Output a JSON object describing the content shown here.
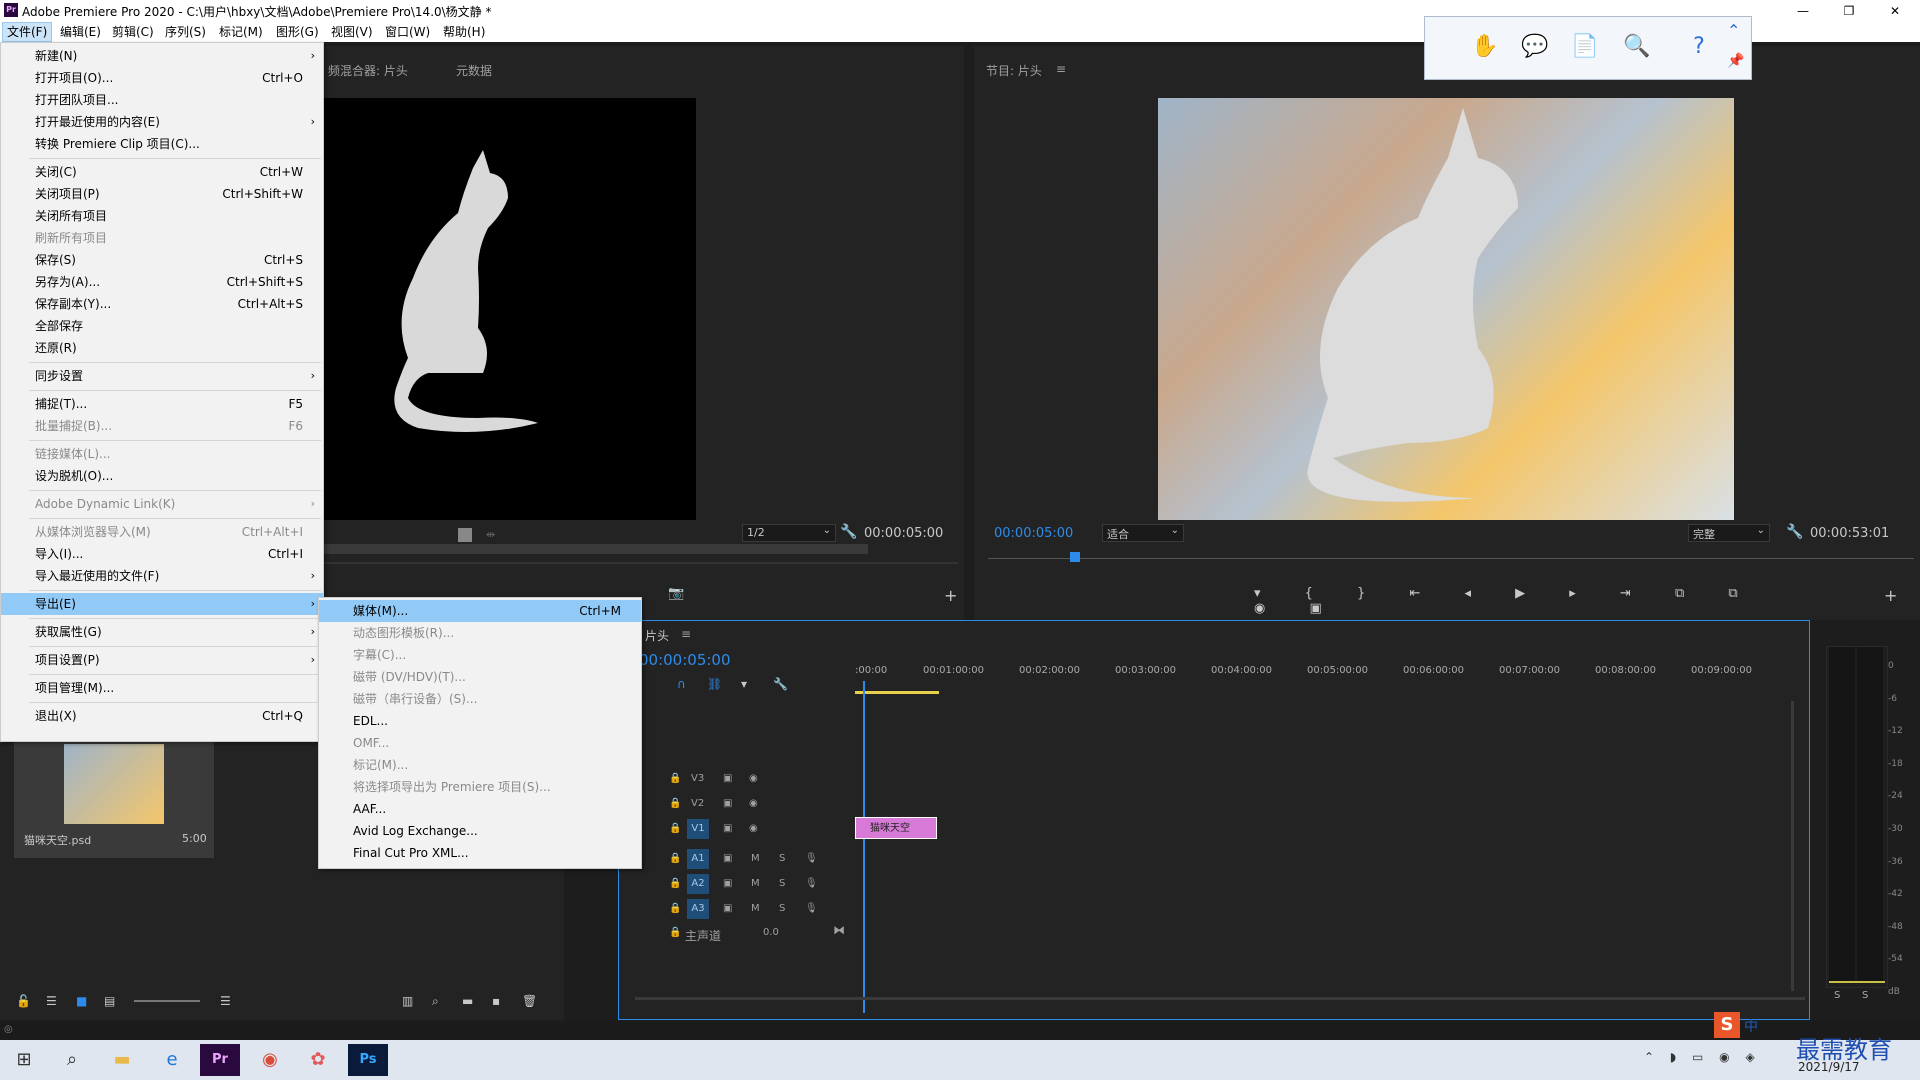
{
  "window": {
    "app_logo": "Pr",
    "title": "Adobe Premiere Pro 2020 - C:\\用户\\hbxy\\文档\\Adobe\\Premiere Pro\\14.0\\杨文静 *",
    "minimize": "—",
    "maximize": "❐",
    "close": "✕"
  },
  "menubar": {
    "items": [
      "文件(F)",
      "编辑(E)",
      "剪辑(C)",
      "序列(S)",
      "标记(M)",
      "图形(G)",
      "视图(V)",
      "窗口(W)",
      "帮助(H)"
    ]
  },
  "file_menu": {
    "items": [
      {
        "label": "新建(N)",
        "shortcut": "",
        "submenu": true,
        "disabled": false
      },
      {
        "label": "打开项目(O)...",
        "shortcut": "Ctrl+O",
        "submenu": false,
        "disabled": false
      },
      {
        "label": "打开团队项目...",
        "shortcut": "",
        "submenu": false,
        "disabled": false
      },
      {
        "label": "打开最近使用的内容(E)",
        "shortcut": "",
        "submenu": true,
        "disabled": false
      },
      {
        "label": "转换 Premiere Clip 项目(C)...",
        "shortcut": "",
        "submenu": false,
        "disabled": false
      },
      {
        "label": "关闭(C)",
        "shortcut": "Ctrl+W",
        "submenu": false,
        "disabled": false
      },
      {
        "label": "关闭项目(P)",
        "shortcut": "Ctrl+Shift+W",
        "submenu": false,
        "disabled": false
      },
      {
        "label": "关闭所有项目",
        "shortcut": "",
        "submenu": false,
        "disabled": false
      },
      {
        "label": "刷新所有项目",
        "shortcut": "",
        "submenu": false,
        "disabled": true
      },
      {
        "label": "保存(S)",
        "shortcut": "Ctrl+S",
        "submenu": false,
        "disabled": false
      },
      {
        "label": "另存为(A)...",
        "shortcut": "Ctrl+Shift+S",
        "submenu": false,
        "disabled": false
      },
      {
        "label": "保存副本(Y)...",
        "shortcut": "Ctrl+Alt+S",
        "submenu": false,
        "disabled": false
      },
      {
        "label": "全部保存",
        "shortcut": "",
        "submenu": false,
        "disabled": false
      },
      {
        "label": "还原(R)",
        "shortcut": "",
        "submenu": false,
        "disabled": false
      },
      {
        "label": "同步设置",
        "shortcut": "",
        "submenu": true,
        "disabled": false
      },
      {
        "label": "捕捉(T)...",
        "shortcut": "F5",
        "submenu": false,
        "disabled": false
      },
      {
        "label": "批量捕捉(B)...",
        "shortcut": "F6",
        "submenu": false,
        "disabled": true
      },
      {
        "label": "链接媒体(L)...",
        "shortcut": "",
        "submenu": false,
        "disabled": true
      },
      {
        "label": "设为脱机(O)...",
        "shortcut": "",
        "submenu": false,
        "disabled": false
      },
      {
        "label": "Adobe Dynamic Link(K)",
        "shortcut": "",
        "submenu": true,
        "disabled": true
      },
      {
        "label": "从媒体浏览器导入(M)",
        "shortcut": "Ctrl+Alt+I",
        "submenu": false,
        "disabled": true
      },
      {
        "label": "导入(I)...",
        "shortcut": "Ctrl+I",
        "submenu": false,
        "disabled": false
      },
      {
        "label": "导入最近使用的文件(F)",
        "shortcut": "",
        "submenu": true,
        "disabled": false
      },
      {
        "label": "导出(E)",
        "shortcut": "",
        "submenu": true,
        "disabled": false,
        "highlighted": true
      },
      {
        "label": "获取属性(G)",
        "shortcut": "",
        "submenu": true,
        "disabled": false
      },
      {
        "label": "项目设置(P)",
        "shortcut": "",
        "submenu": true,
        "disabled": false
      },
      {
        "label": "项目管理(M)...",
        "shortcut": "",
        "submenu": false,
        "disabled": false
      },
      {
        "label": "退出(X)",
        "shortcut": "Ctrl+Q",
        "submenu": false,
        "disabled": false
      }
    ]
  },
  "export_submenu": {
    "items": [
      {
        "label": "媒体(M)...",
        "shortcut": "Ctrl+M",
        "disabled": false,
        "highlighted": true
      },
      {
        "label": "动态图形模板(R)...",
        "shortcut": "",
        "disabled": true
      },
      {
        "label": "字幕(C)...",
        "shortcut": "",
        "disabled": true
      },
      {
        "label": "磁带 (DV/HDV)(T)...",
        "shortcut": "",
        "disabled": true
      },
      {
        "label": "磁带（串行设备）(S)...",
        "shortcut": "",
        "disabled": true
      },
      {
        "label": "EDL...",
        "shortcut": "",
        "disabled": false
      },
      {
        "label": "OMF...",
        "shortcut": "",
        "disabled": true
      },
      {
        "label": "标记(M)...",
        "shortcut": "",
        "disabled": true
      },
      {
        "label": "将选择项导出为 Premiere 项目(S)...",
        "shortcut": "",
        "disabled": true
      },
      {
        "label": "AAF...",
        "shortcut": "",
        "disabled": false
      },
      {
        "label": "Avid Log Exchange...",
        "shortcut": "",
        "disabled": false
      },
      {
        "label": "Final Cut Pro XML...",
        "shortcut": "",
        "disabled": false
      }
    ]
  },
  "source_monitor": {
    "tab_mixer": "频混合器: 片头",
    "tab_metadata": "元数据",
    "zoom": "1/2",
    "timecode": "00:00:05:00"
  },
  "program_monitor": {
    "title": "节目: 片头",
    "timecode_in": "00:00:05:00",
    "fit": "适合",
    "quality": "完整",
    "duration": "00:00:53:01"
  },
  "project_panel": {
    "clip_name": "猫咪天空.psd",
    "clip_duration": "5:00"
  },
  "timeline": {
    "title": "片头",
    "timecode": "00:00:05:00",
    "ruler": [
      ":00:00",
      "00:01:00:00",
      "00:02:00:00",
      "00:03:00:00",
      "00:04:00:00",
      "00:05:00:00",
      "00:06:00:00",
      "00:07:00:00",
      "00:08:00:00",
      "00:09:00:00"
    ],
    "video_tracks": [
      "V3",
      "V2",
      "V1"
    ],
    "audio_tracks": [
      "A1",
      "A2",
      "A3"
    ],
    "master_label": "主声道",
    "master_value": "0.0",
    "clip_label": "猫咪天空",
    "mute": "M",
    "solo": "S"
  },
  "audio_meter": {
    "scale": [
      "0",
      "-6",
      "-12",
      "-18",
      "-24",
      "-30",
      "-36",
      "-42",
      "-48",
      "-54",
      "dB"
    ],
    "solo_left": "S",
    "solo_right": "S"
  },
  "taskbar": {
    "ime": "中",
    "watermark": "最需教育",
    "date": "2021/9/17"
  }
}
